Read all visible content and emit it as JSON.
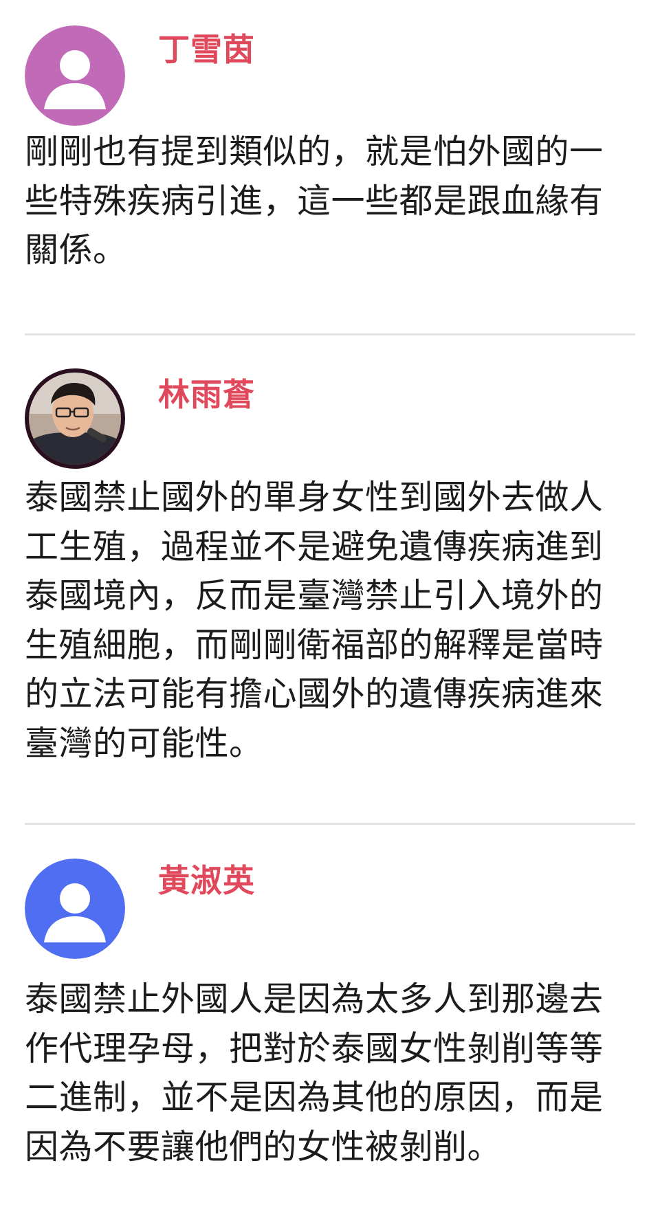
{
  "entries": [
    {
      "avatar": "default-user-avatar-icon",
      "avatar_color": "#c06ab8",
      "speaker": "丁雪茵",
      "text": "剛剛也有提到類似的，就是怕外國的一些特殊疾病引進，這一些都是跟血緣有關係。"
    },
    {
      "avatar": "speaker-photo",
      "speaker": "林雨蒼",
      "text": "泰國禁止國外的單身女性到國外去做人工生殖，過程並不是避免遺傳疾病進到泰國境內，反而是臺灣禁止引入境外的生殖細胞，而剛剛衛福部的解釋是當時的立法可能有擔心國外的遺傳疾病進來臺灣的可能性。"
    },
    {
      "avatar": "default-user-avatar-icon",
      "avatar_color": "#4f6ef2",
      "speaker": "黃淑英",
      "text": "泰國禁止外國人是因為太多人到那邊去作代理孕母，把對於泰國女性剝削等等二進制，並不是因為其他的原因，而是因為不要讓他們的女性被剝削。"
    }
  ],
  "colors": {
    "speaker_name": "#e0485b",
    "body_text": "#1c1c1c",
    "divider": "#e3e3e3",
    "background": "#ffffff"
  }
}
